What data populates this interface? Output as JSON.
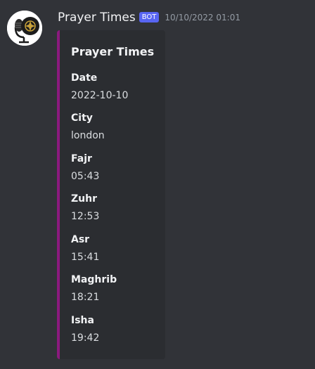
{
  "message": {
    "author": "Prayer Times",
    "bot_tag": "BOT",
    "timestamp": "10/10/2022 01:01",
    "avatar_icon": "mic-microphone-icon"
  },
  "embed": {
    "accent_color": "#8b1a7e",
    "title": "Prayer Times",
    "fields": [
      {
        "name": "Date",
        "value": "2022-10-10"
      },
      {
        "name": "City",
        "value": "london"
      },
      {
        "name": "Fajr",
        "value": "05:43"
      },
      {
        "name": "Zuhr",
        "value": "12:53"
      },
      {
        "name": "Asr",
        "value": "15:41"
      },
      {
        "name": "Maghrib",
        "value": "18:21"
      },
      {
        "name": "Isha",
        "value": "19:42"
      }
    ]
  },
  "colors": {
    "background": "#313338",
    "embed_background": "#2b2d31",
    "bot_tag": "#5865f2"
  }
}
